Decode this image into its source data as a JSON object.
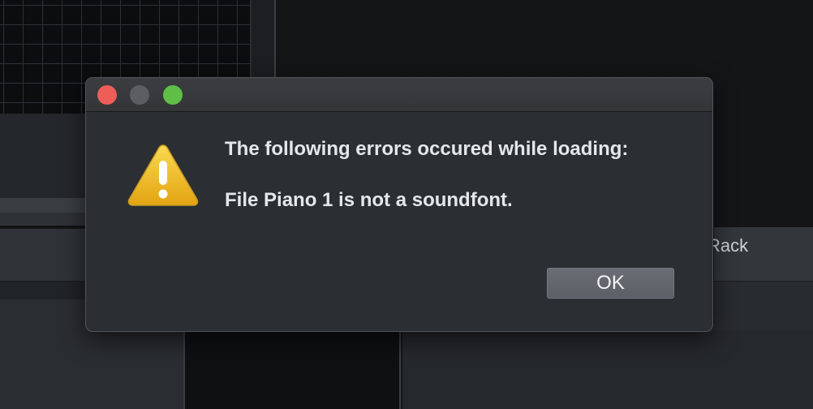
{
  "background": {
    "rack_label": "Rack"
  },
  "dialog": {
    "traffic_lights": {
      "close_color": "#ee5e59",
      "minimize_color": "#5c5e62",
      "zoom_color": "#5fbe46"
    },
    "icon": "warning-triangle-icon",
    "message_line1": "The following errors occured while loading:",
    "message_line2": "File Piano 1 is not a soundfont.",
    "ok_label": "OK"
  }
}
